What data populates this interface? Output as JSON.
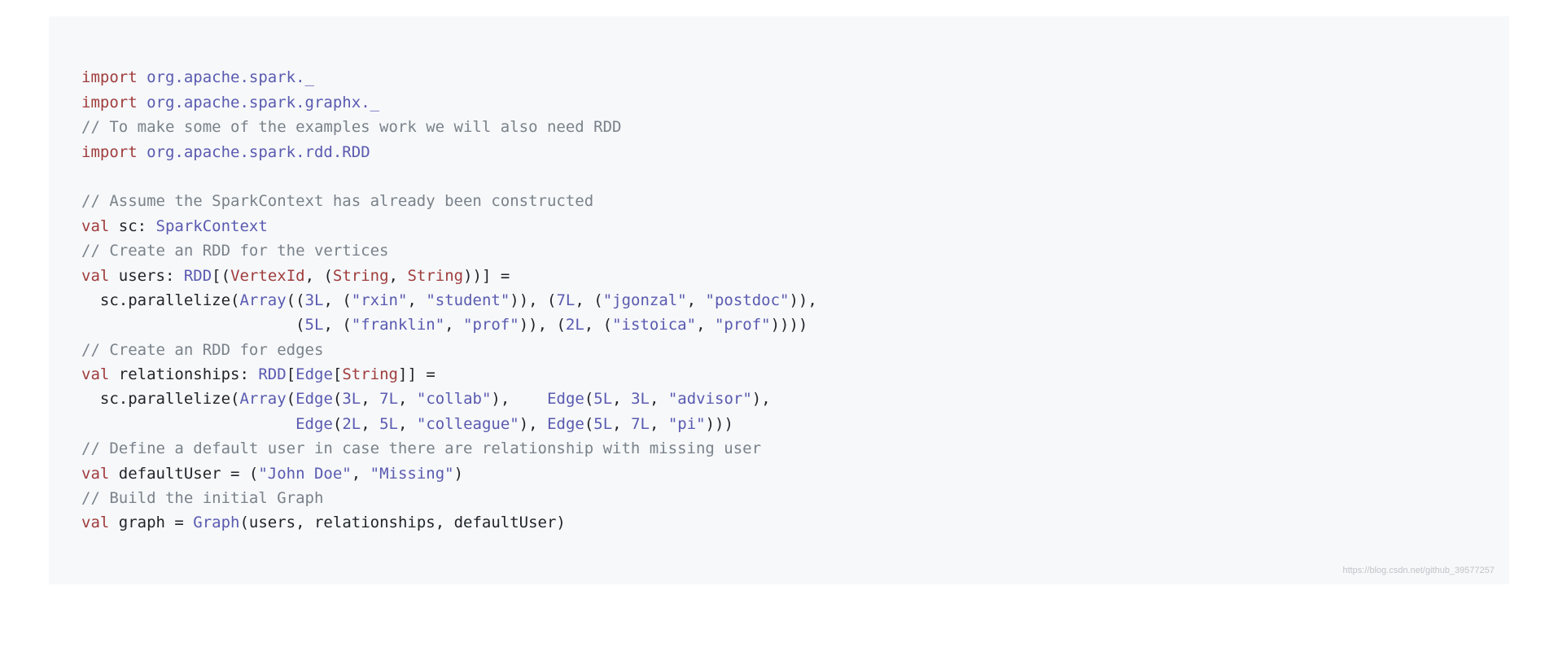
{
  "code": {
    "tokens": [
      [
        {
          "t": "import",
          "c": "tk-keyword"
        },
        {
          "t": " "
        },
        {
          "t": "org.apache.spark._",
          "c": "tk-pkg"
        }
      ],
      [
        {
          "t": "import",
          "c": "tk-keyword"
        },
        {
          "t": " "
        },
        {
          "t": "org.apache.spark.graphx._",
          "c": "tk-pkg"
        }
      ],
      [
        {
          "t": "// To make some of the examples work we will also need RDD",
          "c": "tk-comment"
        }
      ],
      [
        {
          "t": "import",
          "c": "tk-keyword"
        },
        {
          "t": " "
        },
        {
          "t": "org.apache.spark.rdd.RDD",
          "c": "tk-pkg"
        }
      ],
      [
        {
          "t": ""
        }
      ],
      [
        {
          "t": "// Assume the SparkContext has already been constructed",
          "c": "tk-comment"
        }
      ],
      [
        {
          "t": "val",
          "c": "tk-keyword"
        },
        {
          "t": " sc: "
        },
        {
          "t": "SparkContext",
          "c": "tk-pkg"
        }
      ],
      [
        {
          "t": "// Create an RDD for the vertices",
          "c": "tk-comment"
        }
      ],
      [
        {
          "t": "val",
          "c": "tk-keyword"
        },
        {
          "t": " users: "
        },
        {
          "t": "RDD",
          "c": "tk-pkg"
        },
        {
          "t": "[("
        },
        {
          "t": "VertexId",
          "c": "tk-type"
        },
        {
          "t": ", ("
        },
        {
          "t": "String",
          "c": "tk-type"
        },
        {
          "t": ", "
        },
        {
          "t": "String",
          "c": "tk-type"
        },
        {
          "t": "))] ="
        }
      ],
      [
        {
          "t": "  sc.parallelize("
        },
        {
          "t": "Array",
          "c": "tk-pkg"
        },
        {
          "t": "(("
        },
        {
          "t": "3L",
          "c": "tk-num"
        },
        {
          "t": ", ("
        },
        {
          "t": "\"rxin\"",
          "c": "tk-str"
        },
        {
          "t": ", "
        },
        {
          "t": "\"student\"",
          "c": "tk-str"
        },
        {
          "t": ")), ("
        },
        {
          "t": "7L",
          "c": "tk-num"
        },
        {
          "t": ", ("
        },
        {
          "t": "\"jgonzal\"",
          "c": "tk-str"
        },
        {
          "t": ", "
        },
        {
          "t": "\"postdoc\"",
          "c": "tk-str"
        },
        {
          "t": ")),"
        }
      ],
      [
        {
          "t": "                       ("
        },
        {
          "t": "5L",
          "c": "tk-num"
        },
        {
          "t": ", ("
        },
        {
          "t": "\"franklin\"",
          "c": "tk-str"
        },
        {
          "t": ", "
        },
        {
          "t": "\"prof\"",
          "c": "tk-str"
        },
        {
          "t": ")), ("
        },
        {
          "t": "2L",
          "c": "tk-num"
        },
        {
          "t": ", ("
        },
        {
          "t": "\"istoica\"",
          "c": "tk-str"
        },
        {
          "t": ", "
        },
        {
          "t": "\"prof\"",
          "c": "tk-str"
        },
        {
          "t": "))))"
        }
      ],
      [
        {
          "t": "// Create an RDD for edges",
          "c": "tk-comment"
        }
      ],
      [
        {
          "t": "val",
          "c": "tk-keyword"
        },
        {
          "t": " relationships: "
        },
        {
          "t": "RDD",
          "c": "tk-pkg"
        },
        {
          "t": "["
        },
        {
          "t": "Edge",
          "c": "tk-pkg"
        },
        {
          "t": "["
        },
        {
          "t": "String",
          "c": "tk-type"
        },
        {
          "t": "]] ="
        }
      ],
      [
        {
          "t": "  sc.parallelize("
        },
        {
          "t": "Array",
          "c": "tk-pkg"
        },
        {
          "t": "("
        },
        {
          "t": "Edge",
          "c": "tk-pkg"
        },
        {
          "t": "("
        },
        {
          "t": "3L",
          "c": "tk-num"
        },
        {
          "t": ", "
        },
        {
          "t": "7L",
          "c": "tk-num"
        },
        {
          "t": ", "
        },
        {
          "t": "\"collab\"",
          "c": "tk-str"
        },
        {
          "t": "),    "
        },
        {
          "t": "Edge",
          "c": "tk-pkg"
        },
        {
          "t": "("
        },
        {
          "t": "5L",
          "c": "tk-num"
        },
        {
          "t": ", "
        },
        {
          "t": "3L",
          "c": "tk-num"
        },
        {
          "t": ", "
        },
        {
          "t": "\"advisor\"",
          "c": "tk-str"
        },
        {
          "t": "),"
        }
      ],
      [
        {
          "t": "                       "
        },
        {
          "t": "Edge",
          "c": "tk-pkg"
        },
        {
          "t": "("
        },
        {
          "t": "2L",
          "c": "tk-num"
        },
        {
          "t": ", "
        },
        {
          "t": "5L",
          "c": "tk-num"
        },
        {
          "t": ", "
        },
        {
          "t": "\"colleague\"",
          "c": "tk-str"
        },
        {
          "t": "), "
        },
        {
          "t": "Edge",
          "c": "tk-pkg"
        },
        {
          "t": "("
        },
        {
          "t": "5L",
          "c": "tk-num"
        },
        {
          "t": ", "
        },
        {
          "t": "7L",
          "c": "tk-num"
        },
        {
          "t": ", "
        },
        {
          "t": "\"pi\"",
          "c": "tk-str"
        },
        {
          "t": ")))"
        }
      ],
      [
        {
          "t": "// Define a default user in case there are relationship with missing user",
          "c": "tk-comment"
        }
      ],
      [
        {
          "t": "val",
          "c": "tk-keyword"
        },
        {
          "t": " defaultUser = ("
        },
        {
          "t": "\"John Doe\"",
          "c": "tk-str"
        },
        {
          "t": ", "
        },
        {
          "t": "\"Missing\"",
          "c": "tk-str"
        },
        {
          "t": ")"
        }
      ],
      [
        {
          "t": "// Build the initial Graph",
          "c": "tk-comment"
        }
      ],
      [
        {
          "t": "val",
          "c": "tk-keyword"
        },
        {
          "t": " graph = "
        },
        {
          "t": "Graph",
          "c": "tk-pkg"
        },
        {
          "t": "(users, relationships, defaultUser)"
        }
      ]
    ]
  },
  "watermark": "https://blog.csdn.net/github_39577257"
}
